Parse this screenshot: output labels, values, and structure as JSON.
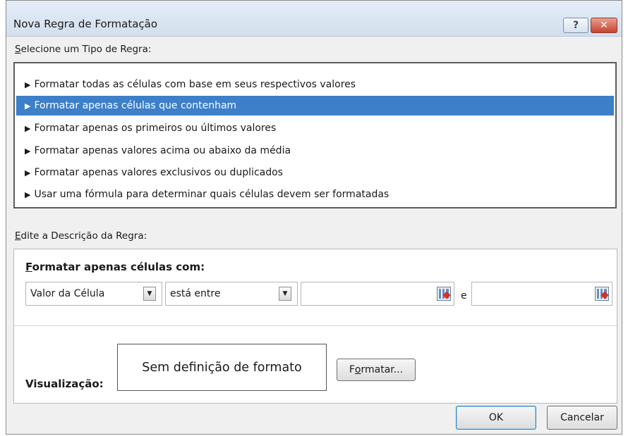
{
  "window": {
    "title": "Nova Regra de Formatação",
    "help_label": "?",
    "close_label": "✕"
  },
  "rule_type": {
    "label_prefix": "S",
    "label_rest": "elecione um Tipo de Regra:",
    "items": [
      {
        "label": "Formatar todas as células com base em seus respectivos valores",
        "selected": false
      },
      {
        "label": "Formatar apenas células que contenham",
        "selected": true
      },
      {
        "label": "Formatar apenas os primeiros ou últimos valores",
        "selected": false
      },
      {
        "label": "Formatar apenas valores acima ou abaixo da média",
        "selected": false
      },
      {
        "label": "Formatar apenas valores exclusivos ou duplicados",
        "selected": false
      },
      {
        "label": "Usar uma fórmula para determinar quais células devem ser formatadas",
        "selected": false
      }
    ],
    "selected_color": "#3d7fc8"
  },
  "description": {
    "label_prefix": "E",
    "label_rest": "dite a Descrição da Regra:",
    "heading_prefix": "F",
    "heading_rest": "ormatar apenas células com:",
    "condition_type": "Valor da Célula",
    "operator": "está entre",
    "value1": "",
    "connector": "e",
    "value2": ""
  },
  "preview": {
    "label": "Visualização:",
    "text": "Sem definição de formato",
    "format_button_prefix": "F",
    "format_button_u": "o",
    "format_button_rest": "rmatar..."
  },
  "footer": {
    "ok_label": "OK",
    "cancel_label": "Cancelar"
  }
}
